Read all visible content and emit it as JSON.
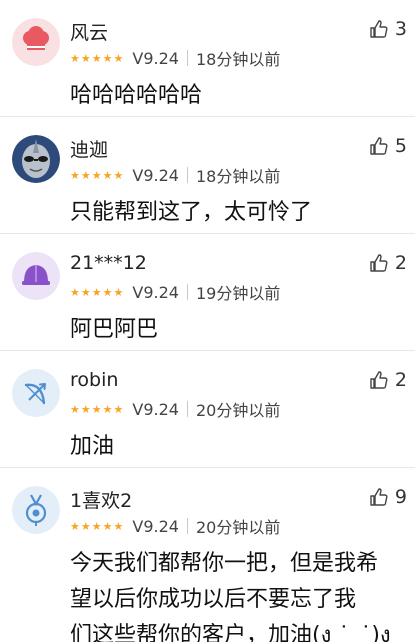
{
  "comments": [
    {
      "username": "风云",
      "rating": 5,
      "version": "V9.24",
      "time": "18分钟以前",
      "likes": "3",
      "content": "哈哈哈哈哈哈",
      "avatar_icon": "chef-hat-icon"
    },
    {
      "username": "迪迦",
      "rating": 5,
      "version": "V9.24",
      "time": "18分钟以前",
      "likes": "5",
      "content": "只能帮到这了，太可怜了",
      "avatar_icon": "ultraman-icon"
    },
    {
      "username": "21***12",
      "rating": 5,
      "version": "V9.24",
      "time": "19分钟以前",
      "likes": "2",
      "content": "阿巴阿巴",
      "avatar_icon": "helmet-icon"
    },
    {
      "username": "robin",
      "rating": 5,
      "version": "V9.24",
      "time": "20分钟以前",
      "likes": "2",
      "content": "加油",
      "avatar_icon": "bow-arrow-icon"
    },
    {
      "username": "1喜欢2",
      "rating": 5,
      "version": "V9.24",
      "time": "20分钟以前",
      "likes": "9",
      "content_lines": [
        "今天我们都帮你一把，但是我希",
        "望以后你成功以后不要忘了我",
        "们这些帮你的客户，加油(ง ˙_˙)ง"
      ],
      "avatar_icon": "medal-icon"
    }
  ],
  "colors": {
    "star": "#f6a623",
    "divider": "#e8e8e8",
    "avatar_bg_pink": "#f9e0e3",
    "avatar_bg_purple": "#ece4f6",
    "avatar_bg_blue": "#e4eef8"
  },
  "icons": {
    "like": "thumbs-up-icon",
    "star": "star-icon"
  }
}
